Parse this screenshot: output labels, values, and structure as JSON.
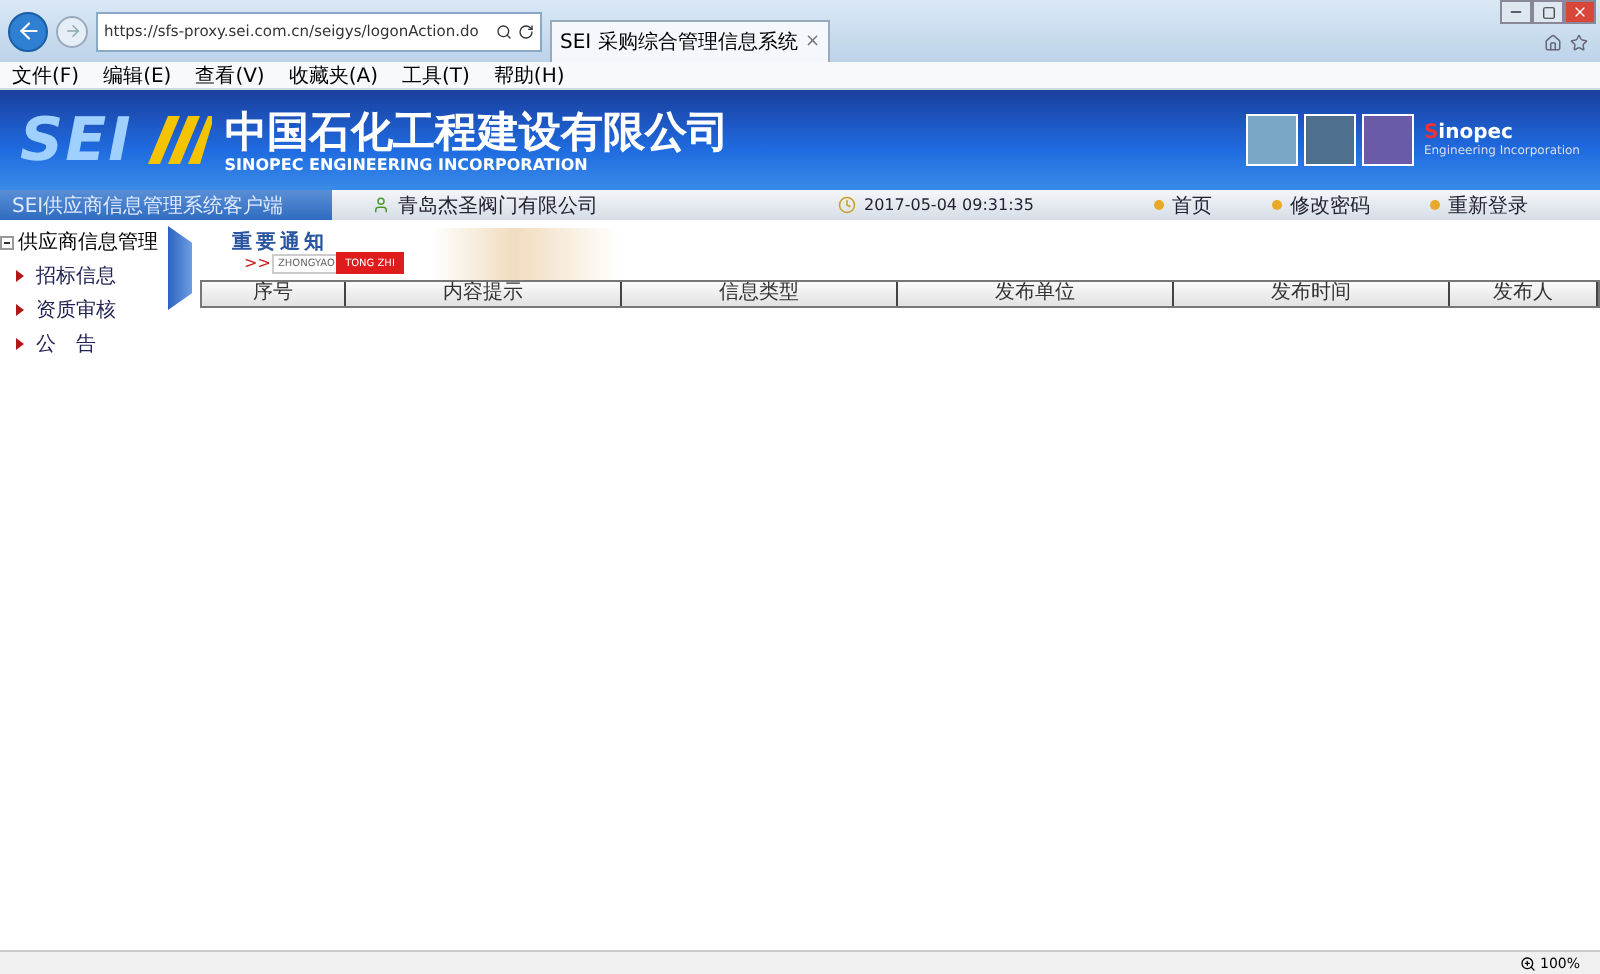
{
  "browser": {
    "address": "https://sfs-proxy.sei.com.cn/seigys/logonAction.do",
    "tab": {
      "title": "SEI 采购综合管理信息系统",
      "close": "×"
    },
    "menu": [
      "文件(F)",
      "编辑(E)",
      "查看(V)",
      "收藏夹(A)",
      "工具(T)",
      "帮助(H)"
    ]
  },
  "banner": {
    "logo": "SEI",
    "company_cn": "中国石化工程建设有限公司",
    "company_en": "SINOPEC ENGINEERING INCORPORATION",
    "brand_initial": "S",
    "brand_rest": "inopec",
    "brand_sub": "Engineering Incorporation"
  },
  "info_bar": {
    "system": "SEI供应商信息管理系统客户端",
    "company": "青岛杰圣阀门有限公司",
    "datetime": "2017-05-04 09:31:35",
    "links": [
      "首页",
      "修改密码",
      "重新登录"
    ]
  },
  "sidebar": {
    "title": "供应商信息管理",
    "expanded": true,
    "items": [
      "招标信息",
      "资质审核",
      "公　告"
    ]
  },
  "notice": {
    "title": "重要通知",
    "arrows": ">>",
    "pinyin_1": "ZHONGYAO",
    "pinyin_2": "TONG ZHI",
    "columns": [
      "序号",
      "内容提示",
      "信息类型",
      "发布单位",
      "发布时间",
      "发布人"
    ]
  },
  "status_bar": {
    "zoom": "100%"
  }
}
